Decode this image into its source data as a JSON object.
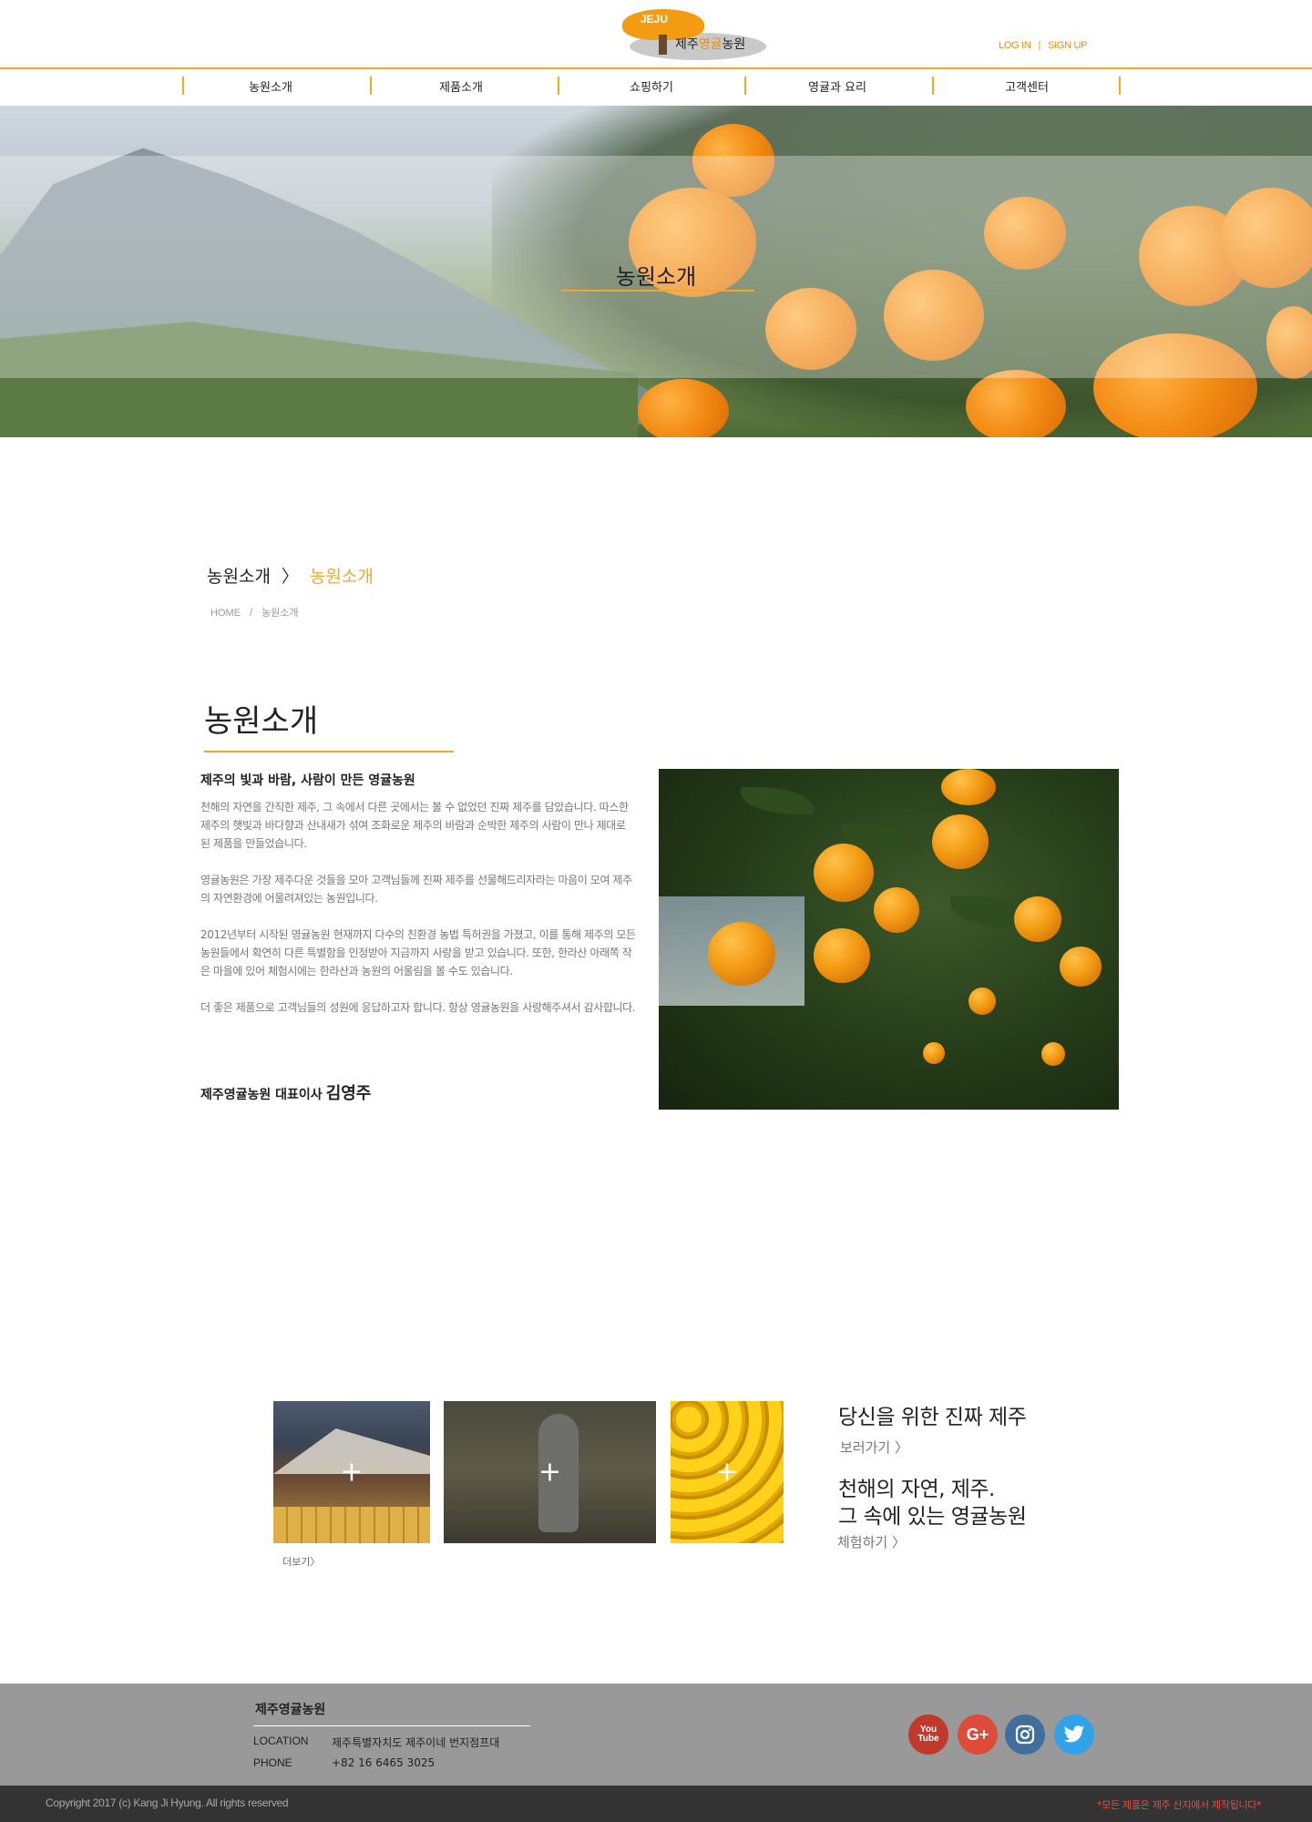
{
  "header": {
    "logo_badge": "JEJU",
    "logo_name_prefix": "제주",
    "logo_name_highlight": "영귤",
    "logo_name_suffix": "농원",
    "login": "LOG IN",
    "separator": "|",
    "signup": "SIGN UP"
  },
  "nav": {
    "items": [
      {
        "label": "농원소개"
      },
      {
        "label": "제품소개"
      },
      {
        "label": "쇼핑하기"
      },
      {
        "label": "영귤과 요리"
      },
      {
        "label": "고객센터"
      }
    ]
  },
  "hero": {
    "title": "농원소개"
  },
  "breadcrumb": {
    "parent": "농원소개",
    "arrow": "〉",
    "current": "농원소개",
    "home": "HOME",
    "sep": "/",
    "path_current": "농원소개"
  },
  "intro": {
    "title": "농원소개",
    "subtitle": "제주의 빛과 바람, 사람이 만든 영귤농원",
    "paragraphs": [
      "천해의 자연을 간직한 제주, 그 속에서 다른 곳에서는 볼 수 없었던 진짜 제주를 담았습니다. 따스한 제주의 햇빛과 바다향과 산내새가 섞여 조화로운 제주의 바람과 순박한 제주의 사람이 만나 제대로 된 제품을 만들었습니다.",
      "영귤농원은 가장 제주다운 것들을 모아 고객님들께 진짜 제주를 선물해드리자라는 마음이 모여 제주의 자연환경에 어울려져있는 농원입니다.",
      "2012년부터 시작된 영귤농원 현재까지 다수의 친환경 농법 특허권을 가졌고, 이를 통해 제주의 모든 농원들에서 확연히 다른 특별함을 인정받아 지금까지 사랑을 받고 있습니다. 또한, 한라산 아래쪽 작은 마을에 있어 체험시에는 한라산과 농원의 어울림을 볼 수도 있습니다.",
      "더 좋은 제품으로 고객님들의 성원에 응답하고자 합니다. 항상 영귤농원을 사랑해주셔서 감사합니다."
    ],
    "signature_prefix": "제주영귤농원 대표이사",
    "signature_name": "김영주"
  },
  "gallery": {
    "plus": "+",
    "more": "더보기〉"
  },
  "promo": {
    "headline1": "당신을 위한 진짜 제주",
    "link1": "보러가기 〉",
    "headline2_line1": "천해의 자연, 제주.",
    "headline2_line2": "그 속에 있는 영귤농원",
    "link2": "체험하기 〉"
  },
  "footer": {
    "title": "제주영귤농원",
    "location_label": "LOCATION",
    "location_value": "제주특별자치도 제주이네 번지점프대",
    "phone_label": "PHONE",
    "phone_value": "+82 16 6465 3025",
    "social": [
      "youtube-icon",
      "google-plus-icon",
      "instagram-icon",
      "twitter-icon"
    ],
    "youtube_text": "You Tube",
    "gplus_text": "G+",
    "copyright": "Copyright 2017 (c) Kang Ji Hyung. All rights reserved",
    "notice": "*모든 제품은 제주 산지에서 제작됩니다*"
  },
  "colors": {
    "accent": "#f5a623",
    "footer_bg": "#999999",
    "bottom_bg": "#333333",
    "notice": "#e74c3c"
  }
}
